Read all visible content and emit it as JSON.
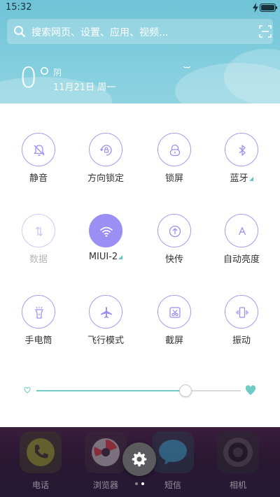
{
  "status_bar": {
    "time": "15:32"
  },
  "search": {
    "placeholder": "搜索网页、设置、应用、视频..."
  },
  "weather": {
    "temperature": "0°",
    "condition": "阴",
    "date": "11月21日 周一"
  },
  "toggles": [
    {
      "label": "静音",
      "icon": "bell-off-icon",
      "state": "off"
    },
    {
      "label": "方向锁定",
      "icon": "rotation-lock-icon",
      "state": "off"
    },
    {
      "label": "锁屏",
      "icon": "lock-icon",
      "state": "off"
    },
    {
      "label": "蓝牙",
      "icon": "bluetooth-icon",
      "state": "off",
      "has_more": true
    },
    {
      "label": "数据",
      "icon": "mobile-data-icon",
      "state": "disabled"
    },
    {
      "label": "MIUI-2",
      "icon": "wifi-icon",
      "state": "on",
      "has_more": true
    },
    {
      "label": "快传",
      "icon": "quick-transfer-icon",
      "state": "off"
    },
    {
      "label": "自动亮度",
      "icon": "auto-brightness-icon",
      "state": "off"
    },
    {
      "label": "手电筒",
      "icon": "flashlight-icon",
      "state": "off"
    },
    {
      "label": "飞行模式",
      "icon": "airplane-icon",
      "state": "off"
    },
    {
      "label": "截屏",
      "icon": "screenshot-icon",
      "state": "off"
    },
    {
      "label": "振动",
      "icon": "vibrate-icon",
      "state": "off"
    }
  ],
  "brightness": {
    "level": 0.73
  },
  "dock": {
    "apps": [
      {
        "label": "电话",
        "color": "#d6e23a"
      },
      {
        "label": "浏览器",
        "color": "#e63c3c"
      },
      {
        "label": "短信",
        "color": "#35c6e8"
      },
      {
        "label": "相机",
        "color": "#3a3a3a"
      }
    ]
  },
  "colors": {
    "accent": "#9b8ff3",
    "brightness": "#6ecbc5",
    "sky": "#7dcbdc"
  }
}
